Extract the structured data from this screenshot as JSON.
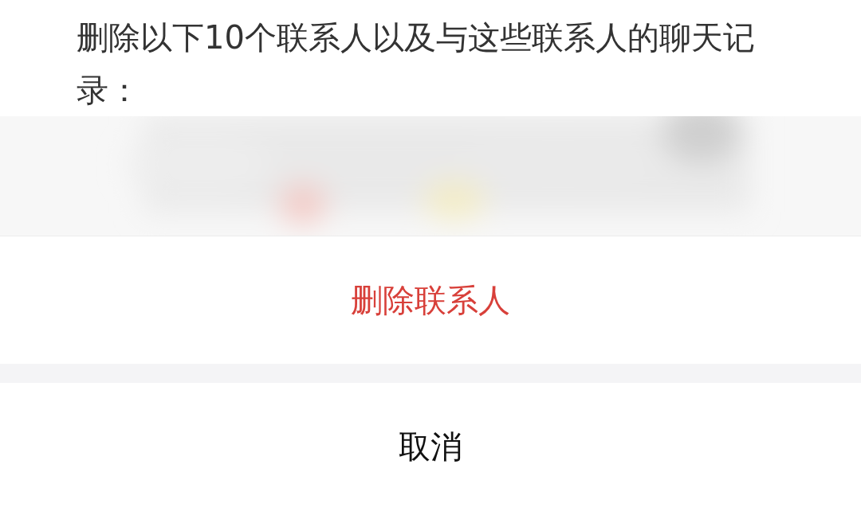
{
  "dialog": {
    "message": "删除以下10个联系人以及与这些联系人的聊天记录：",
    "buttons": [
      {
        "label": "删除联系人",
        "kind": "destructive"
      },
      {
        "label": "取消",
        "kind": "cancel"
      }
    ]
  }
}
